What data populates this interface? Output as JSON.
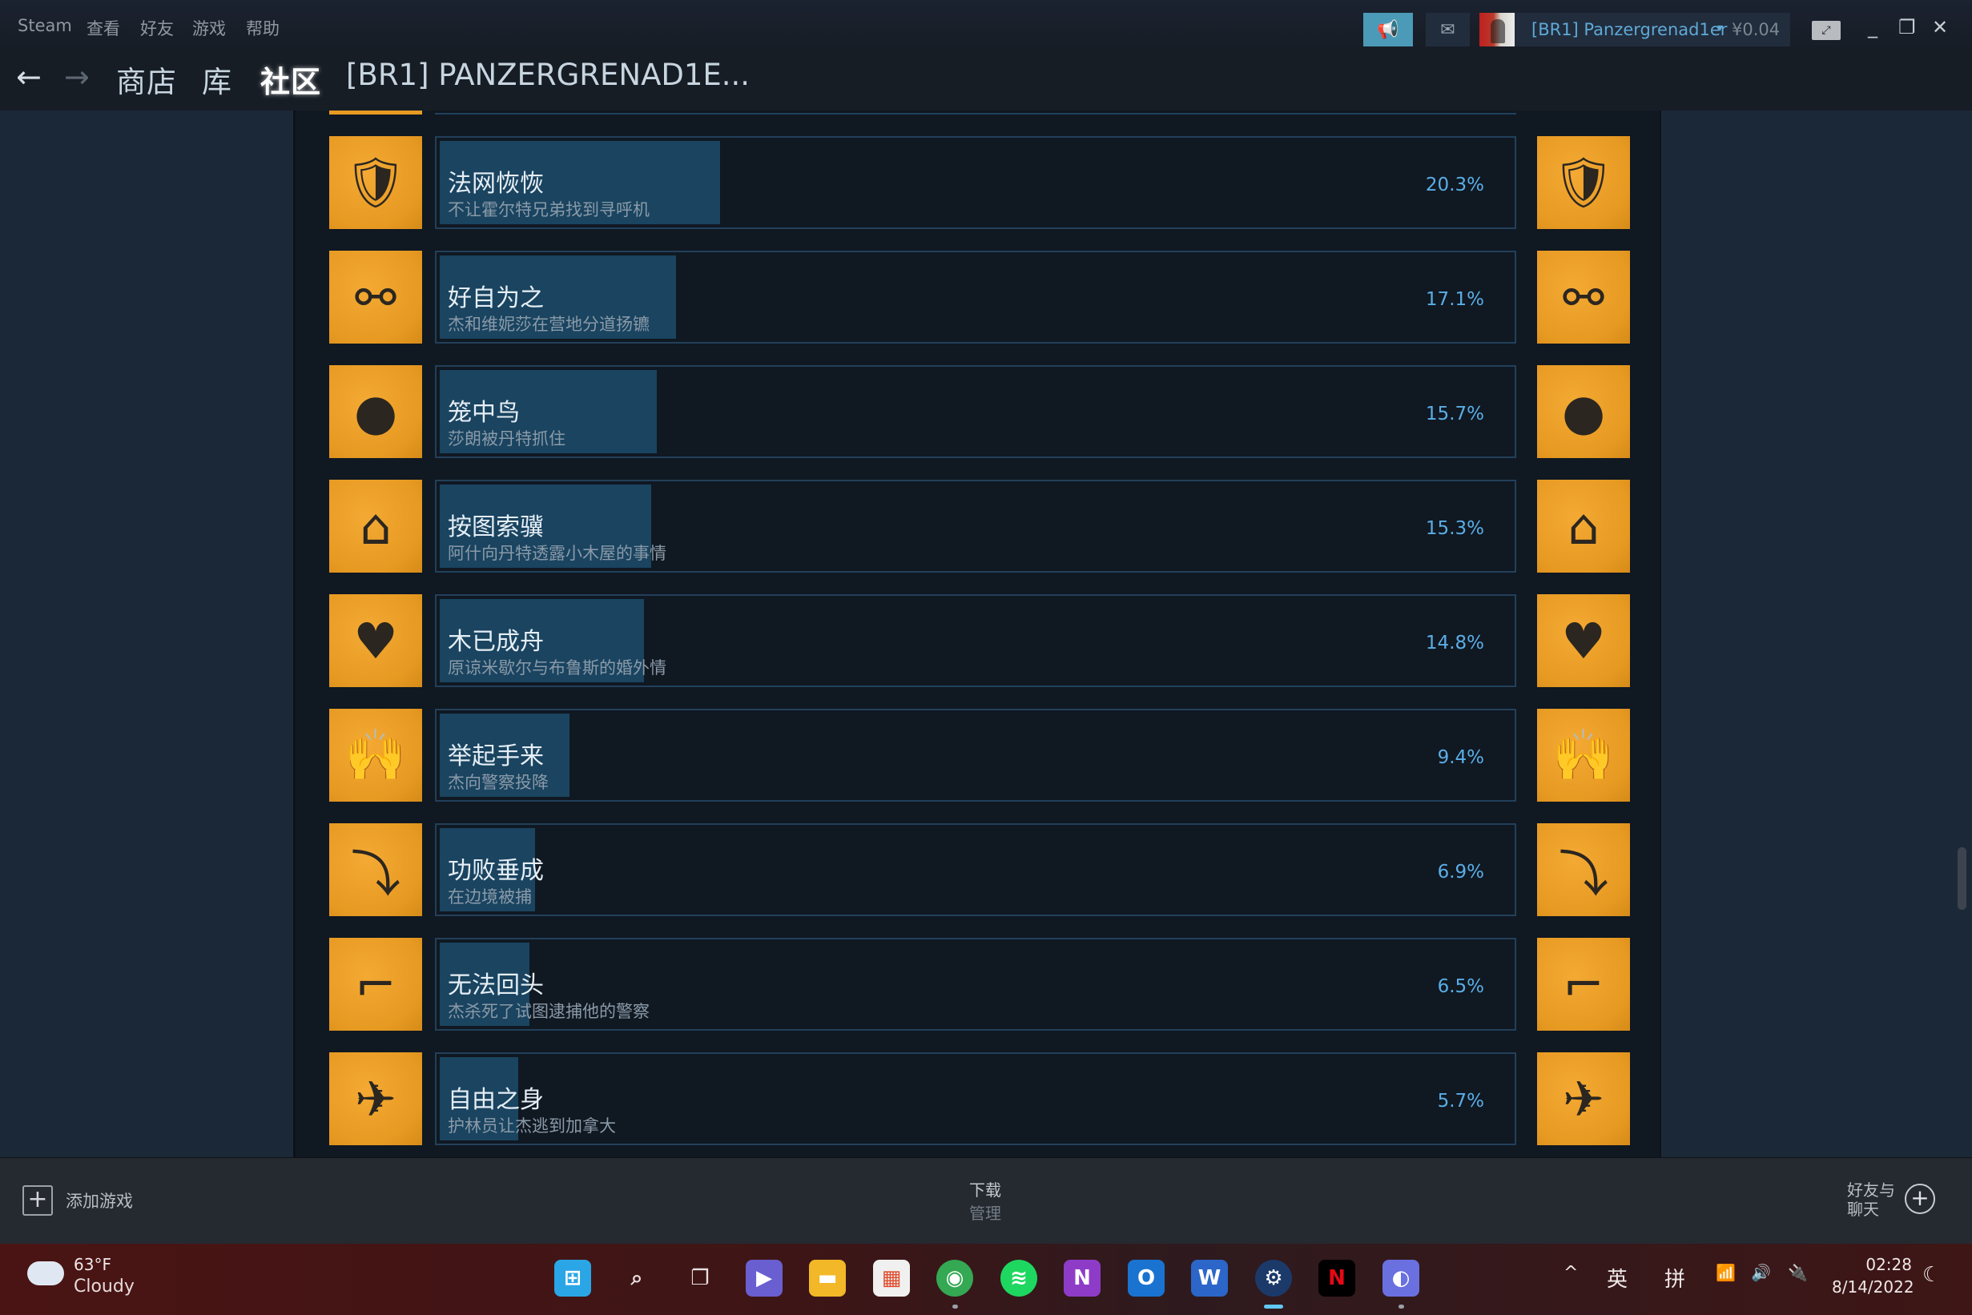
{
  "menubar": {
    "items": [
      "Steam",
      "查看",
      "好友",
      "游戏",
      "帮助"
    ]
  },
  "nav": {
    "back_icon": "←",
    "forward_icon": "→",
    "links": [
      "商店",
      "库",
      "社区"
    ],
    "active_link": "社区",
    "page_title": "[BR1] PANZERGRENAD1E..."
  },
  "titlebar": {
    "announce_icon": "📢",
    "mail_icon": "✉",
    "account_name": "[BR1] Panzergrenad1er",
    "account_caret": "▾",
    "wallet_balance": "¥0.04",
    "bigpicture_icon": "⤢",
    "minimize_icon": "_",
    "restore_icon": "❐",
    "close_icon": "✕"
  },
  "achievements": [
    {
      "title": "法网恢恢",
      "description": "不让霍尔特兄弟找到寻呼机",
      "percent": "20.3%",
      "value": 20.3,
      "icon": "🛡",
      "icon_name": "badge-handcuffs-icon"
    },
    {
      "title": "好自为之",
      "description": "杰和维妮莎在营地分道扬镳",
      "percent": "17.1%",
      "value": 17.1,
      "icon": "⚯",
      "icon_name": "split-people-icon"
    },
    {
      "title": "笼中鸟",
      "description": "莎朗被丹特抓住",
      "percent": "15.7%",
      "value": 15.7,
      "icon": "●",
      "icon_name": "ball-and-chain-icon"
    },
    {
      "title": "按图索骥",
      "description": "阿什向丹特透露小木屋的事情",
      "percent": "15.3%",
      "value": 15.3,
      "icon": "⌂",
      "icon_name": "cabin-footprints-icon"
    },
    {
      "title": "木已成舟",
      "description": "原谅米歇尔与布鲁斯的婚外情",
      "percent": "14.8%",
      "value": 14.8,
      "icon": "♥",
      "icon_name": "bandaged-heart-icon"
    },
    {
      "title": "举起手来",
      "description": "杰向警察投降",
      "percent": "9.4%",
      "value": 9.4,
      "icon": "🙌",
      "icon_name": "hands-up-icon"
    },
    {
      "title": "功败垂成",
      "description": "在边境被捕",
      "percent": "6.9%",
      "value": 6.9,
      "icon": "⤵",
      "icon_name": "fallen-person-icon"
    },
    {
      "title": "无法回头",
      "description": "杰杀死了试图逮捕他的警察",
      "percent": "6.5%",
      "value": 6.5,
      "icon": "⌐",
      "icon_name": "smoking-gun-icon"
    },
    {
      "title": "自由之身",
      "description": "护林员让杰逃到加拿大",
      "percent": "5.7%",
      "value": 5.7,
      "icon": "✈",
      "icon_name": "birds-icon"
    }
  ],
  "footer": {
    "add_game_icon": "+",
    "add_game_label": "添加游戏",
    "downloads_label": "下载",
    "downloads_sub": "管理",
    "friends_line1": "好友与",
    "friends_line2": "聊天",
    "friends_icon": "+"
  },
  "taskbar": {
    "weather_temp": "63°F",
    "weather_desc": "Cloudy",
    "apps": [
      {
        "name": "start-icon",
        "glyph": "⊞",
        "bg": "#2aa6e6"
      },
      {
        "name": "search-icon",
        "glyph": "⌕",
        "bg": "transparent"
      },
      {
        "name": "task-view-icon",
        "glyph": "❐",
        "bg": "transparent"
      },
      {
        "name": "teams-chat-icon",
        "glyph": "▶",
        "bg": "#6a5fd0"
      },
      {
        "name": "file-explorer-icon",
        "glyph": "▬",
        "bg": "#f2b827"
      },
      {
        "name": "microsoft-store-icon",
        "glyph": "▦",
        "bg": "#f0f0f0"
      },
      {
        "name": "chrome-icon",
        "glyph": "◉",
        "bg": "#34a853"
      },
      {
        "name": "spotify-icon",
        "glyph": "≋",
        "bg": "#1ed760"
      },
      {
        "name": "onenote-icon",
        "glyph": "N",
        "bg": "#8e3cc8"
      },
      {
        "name": "outlook-icon",
        "glyph": "O",
        "bg": "#1a73d0"
      },
      {
        "name": "word-icon",
        "glyph": "W",
        "bg": "#2b66c8"
      },
      {
        "name": "steam-icon",
        "glyph": "⚙",
        "bg": "#1b3a6a"
      },
      {
        "name": "netflix-icon",
        "glyph": "N",
        "bg": "#000000"
      },
      {
        "name": "app-icon",
        "glyph": "◐",
        "bg": "#6a70e0"
      }
    ],
    "tray_chevron": "^",
    "ime_lang": "英",
    "ime_mode": "拼",
    "wifi_icon": "📶",
    "volume_icon": "🔊",
    "battery_icon": "🔌",
    "time": "02:28",
    "date": "8/14/2022",
    "focus_icon": "☾"
  }
}
